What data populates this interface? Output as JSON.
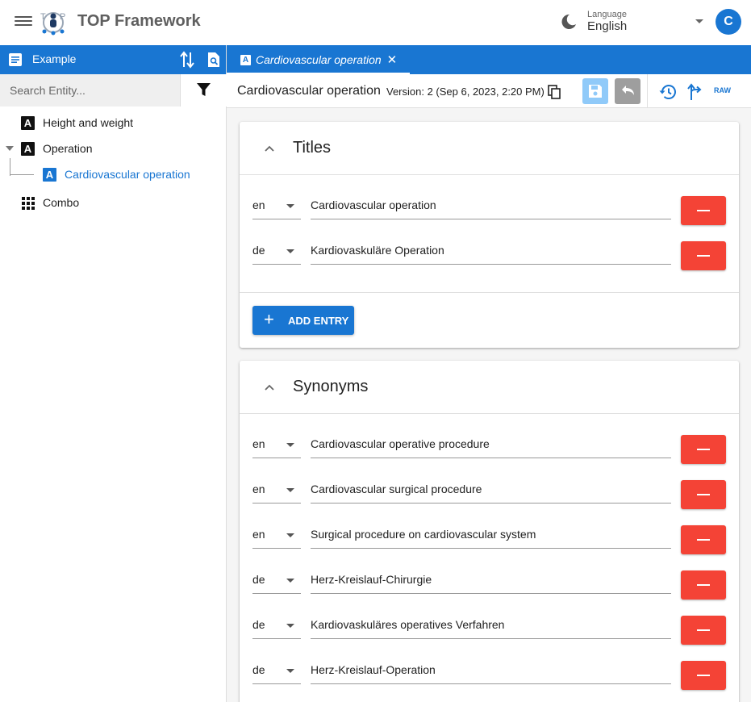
{
  "app": {
    "title": "TOP Framework"
  },
  "header": {
    "language_caption": "Language",
    "language_value": "English",
    "avatar_initial": "C"
  },
  "sidebar": {
    "repository": "Example",
    "search_placeholder": "Search Entity...",
    "tree": [
      {
        "label": "Height and weight",
        "icon": "a-icon"
      },
      {
        "label": "Operation",
        "icon": "a-icon",
        "expanded": true
      },
      {
        "label": "Cardiovascular operation",
        "icon": "a-icon",
        "selected": true
      },
      {
        "label": "Combo",
        "icon": "grid-icon"
      }
    ]
  },
  "tab": {
    "label": "Cardiovascular operation",
    "close": "✕"
  },
  "toolbar": {
    "entity_name": "Cardiovascular operation",
    "version": "Version: 2 (Sep 6, 2023, 2:20 PM)",
    "raw_label": "RAW"
  },
  "titles": {
    "heading": "Titles",
    "entries": [
      {
        "lang": "en",
        "text": "Cardiovascular operation"
      },
      {
        "lang": "de",
        "text": "Kardiovaskuläre Operation"
      }
    ],
    "add_label": "ADD ENTRY"
  },
  "synonyms": {
    "heading": "Synonyms",
    "entries": [
      {
        "lang": "en",
        "text": "Cardiovascular operative procedure"
      },
      {
        "lang": "en",
        "text": "Cardiovascular surgical procedure"
      },
      {
        "lang": "en",
        "text": "Surgical procedure on cardiovascular system"
      },
      {
        "lang": "de",
        "text": "Herz-Kreislauf-Chirurgie"
      },
      {
        "lang": "de",
        "text": "Kardiovaskuläres operatives Verfahren"
      },
      {
        "lang": "de",
        "text": "Herz-Kreislauf-Operation"
      }
    ]
  },
  "colors": {
    "primary": "#1976d2",
    "danger": "#f44336",
    "save_disabled": "#90caf9",
    "undo_disabled": "#9e9e9e"
  }
}
